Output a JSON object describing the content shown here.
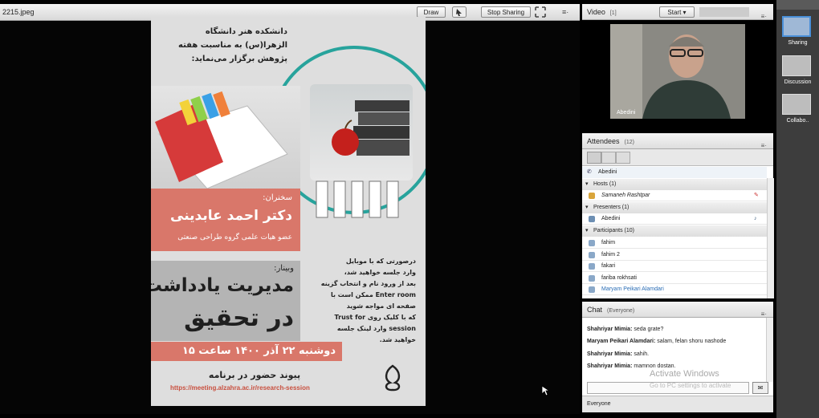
{
  "share": {
    "filename": "2215.jpeg",
    "draw_label": "Draw",
    "stop_label": "Stop Sharing"
  },
  "poster": {
    "header": [
      "دانشکده هنر دانشگاه",
      "الزهرا(س) به مناسبت هفته",
      "پژوهش برگزار می‌نماید:"
    ],
    "speaker_label": "سخنران:",
    "speaker_name": "دکتر احمد عابدینی",
    "speaker_title": "عضو هیات علمی گروه طراحی صنعتی",
    "webinar_label": "وبینار:",
    "webinar_title_1": "مدیریت یادداشت‌ها",
    "webinar_title_2": "در تحقیق",
    "date": "دوشنبه ۲۲ آذر ۱۴۰۰ ساعت ۱۵",
    "link_label": "پیوند حضور در برنامه",
    "url": "https://meeting.alzahra.ac.ir/research-session",
    "instructions": [
      "درصورتی که با موبایل",
      "وارد جلسه خواهید شد،",
      "بعد از ورود نام و انتخاب گزینه",
      "Enter room ممکن است با",
      "صفحه ای مواجه شوید",
      "که با کلیک روی Trust for",
      "session وارد لینک جلسه",
      "خواهید شد."
    ]
  },
  "video": {
    "title": "Video",
    "count": "[1]",
    "start_label": "Start",
    "feed_name": "Abedini"
  },
  "attendees": {
    "title": "Attendees",
    "count": "(12)",
    "me": "Abedini",
    "hosts_label": "Hosts (1)",
    "hosts": [
      "Samaneh Rashtpar"
    ],
    "presenters_label": "Presenters (1)",
    "presenters": [
      "Abedini"
    ],
    "participants_label": "Participants (10)",
    "participants": [
      "fahim",
      "fahim 2",
      "fakari",
      "fariba rokhsati",
      "Maryam Peikari Alamdari"
    ]
  },
  "chat": {
    "title": "Chat",
    "scope": "(Everyone)",
    "messages": [
      {
        "sender": "Shahriyar Mimia:",
        "text": "seda grate?"
      },
      {
        "sender": "Maryam Peikari Alamdari:",
        "text": "salam, felan shoru nashode"
      },
      {
        "sender": "Shahriyar Mimia:",
        "text": "sahih."
      },
      {
        "sender": "Shahriyar Mimia:",
        "text": "mamnon dostan."
      }
    ],
    "recipient": "Everyone",
    "watermark_1": "Activate Windows",
    "watermark_2": "Go to PC settings to activate"
  },
  "layouts": {
    "items": [
      "Sharing",
      "Discussion",
      "Collabo.."
    ]
  }
}
